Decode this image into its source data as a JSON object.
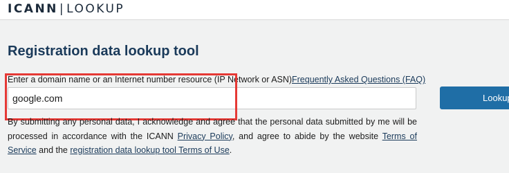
{
  "header": {
    "brand": "ICANN",
    "separator": "|",
    "product": "LOOKUP"
  },
  "main": {
    "title": "Registration data lookup tool",
    "field_label": "Enter a domain name or an Internet number resource (IP Network or ASN)",
    "faq_link": "Frequently Asked Questions (FAQ)",
    "search_value": "google.com",
    "lookup_button": "Lookup",
    "disclaimer": {
      "part1": "By submitting any personal data, I acknowledge and agree that the personal data submitted by me will be processed in accordance with the ICANN ",
      "privacy_link": "Privacy Policy",
      "part2": ", and agree to abide by the website ",
      "tos_link": "Terms of Service",
      "part3": " and the ",
      "rdlt_link": "registration data lookup tool Terms of Use",
      "part4": "."
    }
  },
  "colors": {
    "accent": "#1f6ea6",
    "title": "#1a3a5a",
    "highlight": "#e53935",
    "background": "#f1f2f2"
  }
}
